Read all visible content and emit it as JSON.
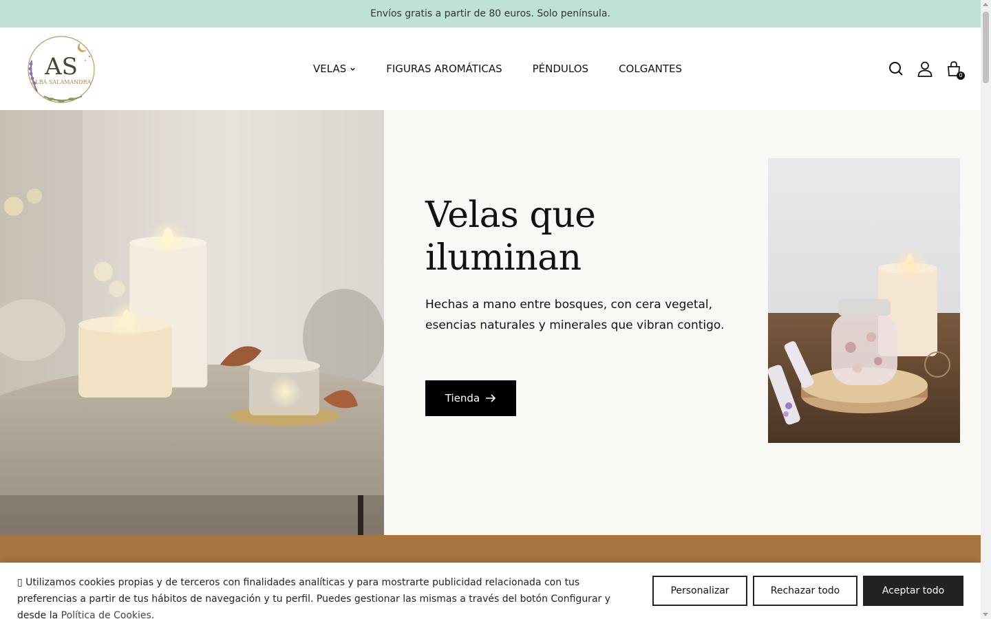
{
  "announcement": "Envíos gratis a partir de 80 euros. Solo península.",
  "logo": {
    "text_top": "AS",
    "text_bottom": "ALBA SALAMANDRA"
  },
  "nav": {
    "items": [
      {
        "label": "VELAS",
        "has_dropdown": true
      },
      {
        "label": "FIGURAS AROMÁTICAS"
      },
      {
        "label": "PÉNDULOS"
      },
      {
        "label": "COLGANTES"
      }
    ]
  },
  "header_icons": {
    "search": "search-icon",
    "account": "user-icon",
    "cart": "bag-icon",
    "cart_count": "0"
  },
  "hero": {
    "title_line1": "Velas que",
    "title_line2": "iluminan",
    "subtitle": "Hechas a mano entre bosques, con cera vegetal, esencias naturales y minerales que vibran contigo.",
    "button_label": "Tienda"
  },
  "colors": {
    "announce_bg": "#bfe2d4",
    "band": "#a8743f",
    "hero_bg": "#faf8f4"
  },
  "cookies": {
    "text": "Utilizamos cookies propias y de terceros con finalidades analíticas y para mostrarte publicidad relacionada con tus preferencias a partir de tus hábitos de navegación y tu perfil. Puedes gestionar las mismas a través del botón Configurar y desde la",
    "link": "Política de Cookies",
    "customize": "Personalizar",
    "reject": "Rechazar todo",
    "accept": "Aceptar todo"
  }
}
